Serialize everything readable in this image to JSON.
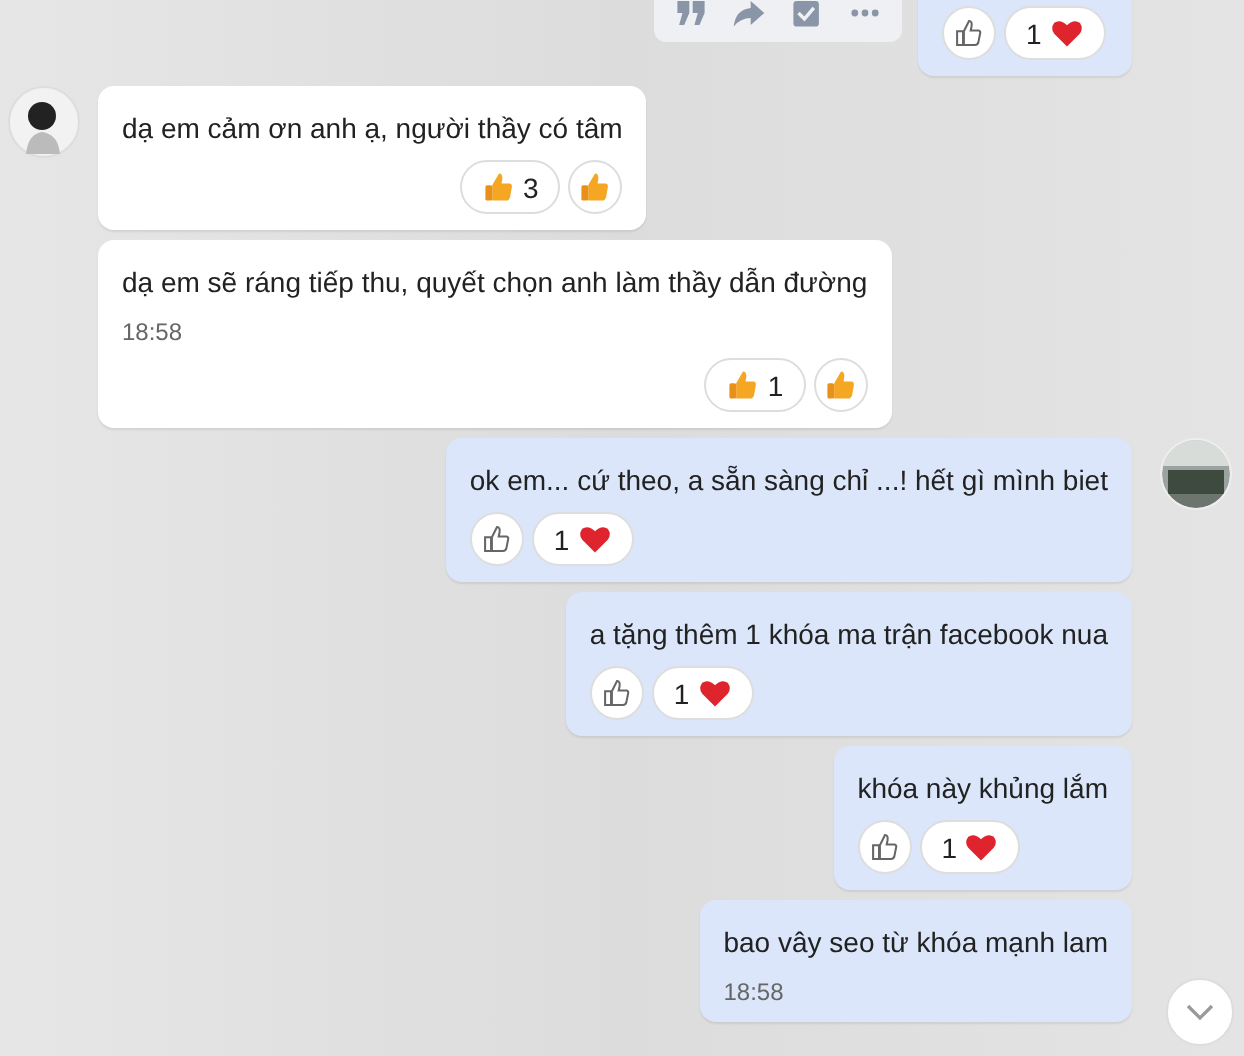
{
  "top_partial": {
    "toolbar": [
      {
        "kind": "quote"
      },
      {
        "kind": "share"
      },
      {
        "kind": "task"
      },
      {
        "kind": "more"
      }
    ],
    "reaction": {
      "count": "1",
      "kind": "heart"
    }
  },
  "messages": [
    {
      "kind": "incoming",
      "avatar": true,
      "text": "dạ em cảm ơn anh ạ, người thầy có tâm",
      "reaction": {
        "count": "3",
        "kind": "thumb"
      },
      "quick": {
        "kind": "thumb"
      }
    },
    {
      "kind": "incoming",
      "avatar": false,
      "text": "dạ em sẽ ráng tiếp thu, quyết chọn anh làm thầy dẫn đường",
      "time": "18:58",
      "reaction": {
        "count": "1",
        "kind": "thumb"
      },
      "quick": {
        "kind": "thumb"
      }
    },
    {
      "kind": "outgoing",
      "avatar": true,
      "text": "ok em... cứ theo, a sẵn sàng chỉ ...! hết gì mình biet",
      "reaction": {
        "count": "1",
        "kind": "heart"
      },
      "quick": {
        "kind": "like"
      }
    },
    {
      "kind": "outgoing",
      "avatar": false,
      "text": "a tặng thêm 1 khóa ma trận facebook nua",
      "reaction": {
        "count": "1",
        "kind": "heart"
      },
      "quick": {
        "kind": "like"
      }
    },
    {
      "kind": "outgoing",
      "avatar": false,
      "text": "khóa này khủng lắm",
      "reaction": {
        "count": "1",
        "kind": "heart"
      },
      "quick": {
        "kind": "like"
      }
    },
    {
      "kind": "outgoing",
      "avatar": false,
      "text": "bao vây seo từ khóa mạnh lam",
      "time": "18:58"
    }
  ]
}
